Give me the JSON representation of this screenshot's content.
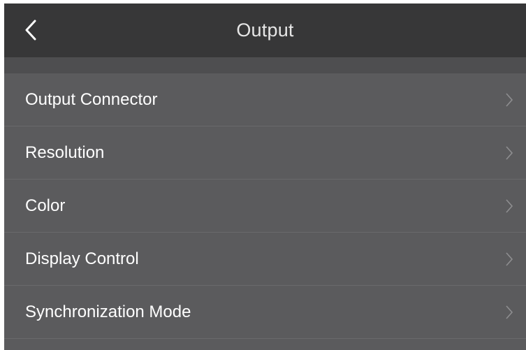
{
  "header": {
    "title": "Output",
    "back_icon": "chevron-left-icon"
  },
  "menu": {
    "items": [
      {
        "label": "Output Connector",
        "icon": "chevron-right-icon"
      },
      {
        "label": "Resolution",
        "icon": "chevron-right-icon"
      },
      {
        "label": "Color",
        "icon": "chevron-right-icon"
      },
      {
        "label": "Display Control",
        "icon": "chevron-right-icon"
      },
      {
        "label": "Synchronization Mode",
        "icon": "chevron-right-icon"
      }
    ]
  },
  "colors": {
    "header_bg": "#373738",
    "list_bg": "#5b5b5d",
    "text": "#ffffff",
    "chevron": "#8e8e90"
  }
}
